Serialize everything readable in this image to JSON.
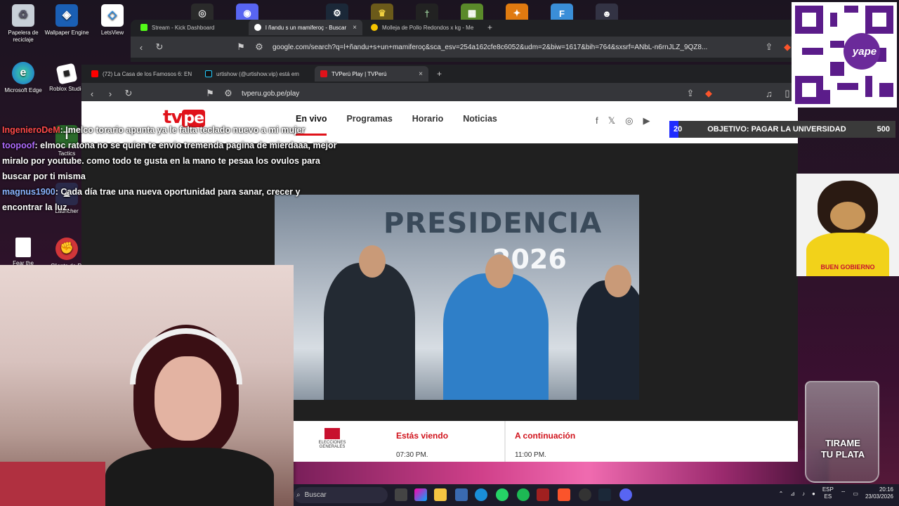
{
  "desktop": {
    "icons": [
      {
        "label": "Papelera de reciclaje",
        "name": "recycle-bin-icon"
      },
      {
        "label": "Wallpaper Engine",
        "name": "wallpaper-engine-icon"
      },
      {
        "label": "LetsView",
        "name": "letsview-icon"
      },
      {
        "label": "Microsoft Edge",
        "name": "edge-icon"
      },
      {
        "label": "Roblox Studio",
        "name": "roblox-icon"
      },
      {
        "label": "Tactics",
        "name": "tactics-icon"
      },
      {
        "label": "Launcher",
        "name": "launcher-icon"
      },
      {
        "label": "Fear the",
        "name": "file-icon"
      },
      {
        "label": "Cliente de Ri",
        "name": "riot-icon"
      }
    ]
  },
  "browser_back": {
    "tabs": [
      {
        "label": "Stream - Kick Dashboard"
      },
      {
        "label": "l ñandu s un mamiferoç - Buscar"
      },
      {
        "label": "Molleja de Pollo Redondos x kg - Me"
      }
    ],
    "url": "google.com/search?q=l+ñandu+s+un+mamiferoç&sca_esv=254a162cfe8c6052&udm=2&biw=1617&bih=764&sxsrf=ANbL-n6rnJLZ_9QZ8..."
  },
  "browser_front": {
    "tabs": [
      {
        "label": "(72) La Casa de los Famosos 6: EN"
      },
      {
        "label": "urtishow (@urtishow.vip) está em"
      },
      {
        "label": "TVPerú Play | TVPerú"
      }
    ],
    "url": "tvperu.gob.pe/play"
  },
  "tvpe": {
    "logo_tv": "tv",
    "logo_pe": "pe",
    "nav": {
      "live": "En vivo",
      "programs": "Programas",
      "schedule": "Horario",
      "news": "Noticias"
    },
    "video": {
      "banner": "PRESIDENCIA",
      "year": "2026"
    },
    "now": {
      "label": "Estás viendo",
      "time": "07:30 PM.",
      "org": "ELECCIONES GENERALES"
    },
    "next": {
      "label": "A continuación",
      "time": "11:00 PM."
    }
  },
  "chat": [
    {
      "user": "IngenieroDeM",
      "color": "red",
      "msg": ": Imelco torario apunta ya le falta teclado nuevo a mi mujer"
    },
    {
      "user": "toopoof",
      "color": "purple",
      "msg": ": elmoc ratona no se quien te envio tremenda pagina de mierdaaa, mejor miralo por youtube. como todo te gusta en la mano te pesaa los ovulos para buscar por ti misma"
    },
    {
      "user": "magnus1900",
      "color": "blue",
      "msg": ": Cada día trae una nueva oportunidad para sanar, crecer y encontrar la luz."
    }
  ],
  "goal": {
    "current": "20",
    "label": "OBJETIVO: PAGAR LA UNIVERSIDAD",
    "target": "500",
    "progress": 0.04
  },
  "qr": {
    "brand": "yape"
  },
  "dog": {
    "shirt": "BUEN GOBIERNO"
  },
  "tipjar": {
    "line1": "TIRAME",
    "line2": "TU PLATA"
  },
  "taskbar": {
    "search": "Buscar",
    "lang": "ESP",
    "lang2": "ES",
    "time": "20:16",
    "date": "23/03/2026"
  },
  "colors": {
    "tvpe_red": "#e0121a",
    "goal_fill": "#1f2bff"
  }
}
